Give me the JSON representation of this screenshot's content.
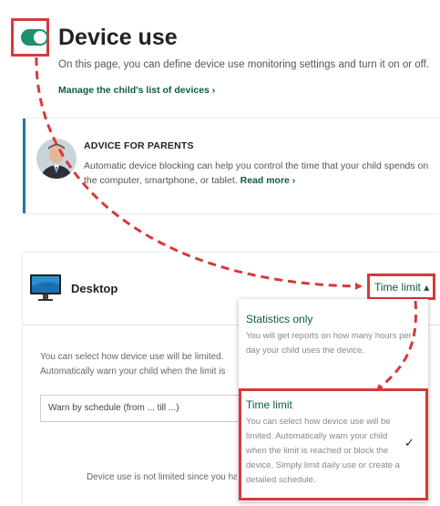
{
  "page": {
    "title": "Device use",
    "subtitle": "On this page, you can define device use monitoring settings and turn it on or off.",
    "manage_link": "Manage the child's list of devices ›"
  },
  "toggle": {
    "state": "on",
    "color": "#1f8f6e"
  },
  "advice": {
    "heading": "ADVICE FOR PARENTS",
    "body": "Automatic device blocking can help you control the time that your child spends on the computer, smartphone, or tablet.",
    "read_more": "Read more ›",
    "accent_color": "#1f7aa8"
  },
  "device": {
    "name": "Desktop",
    "icon": "monitor-icon",
    "limit_label": "Time limit ▴",
    "description": "You can select how device use will be limited. Automatically warn your child when the limit is reached or block the device. Simply limit daily use or create a detailed schedule.",
    "select_value": "Warn by schedule (from ... till ...)",
    "bottom_note": "Device use is not limited since you have"
  },
  "dropdown": {
    "options": [
      {
        "title": "Statistics only",
        "desc": "You will get reports on how many hours per day your child uses the device.",
        "selected": false
      },
      {
        "title": "Time limit",
        "desc": "You can select how device use will be limited. Automatically warn your child when the limit is reached or block the device. Simply limit daily use or create a detailed schedule.",
        "selected": true
      }
    ],
    "checkmark": "✓"
  },
  "colors": {
    "highlight": "#d63a3a",
    "link": "#0f5a42"
  }
}
